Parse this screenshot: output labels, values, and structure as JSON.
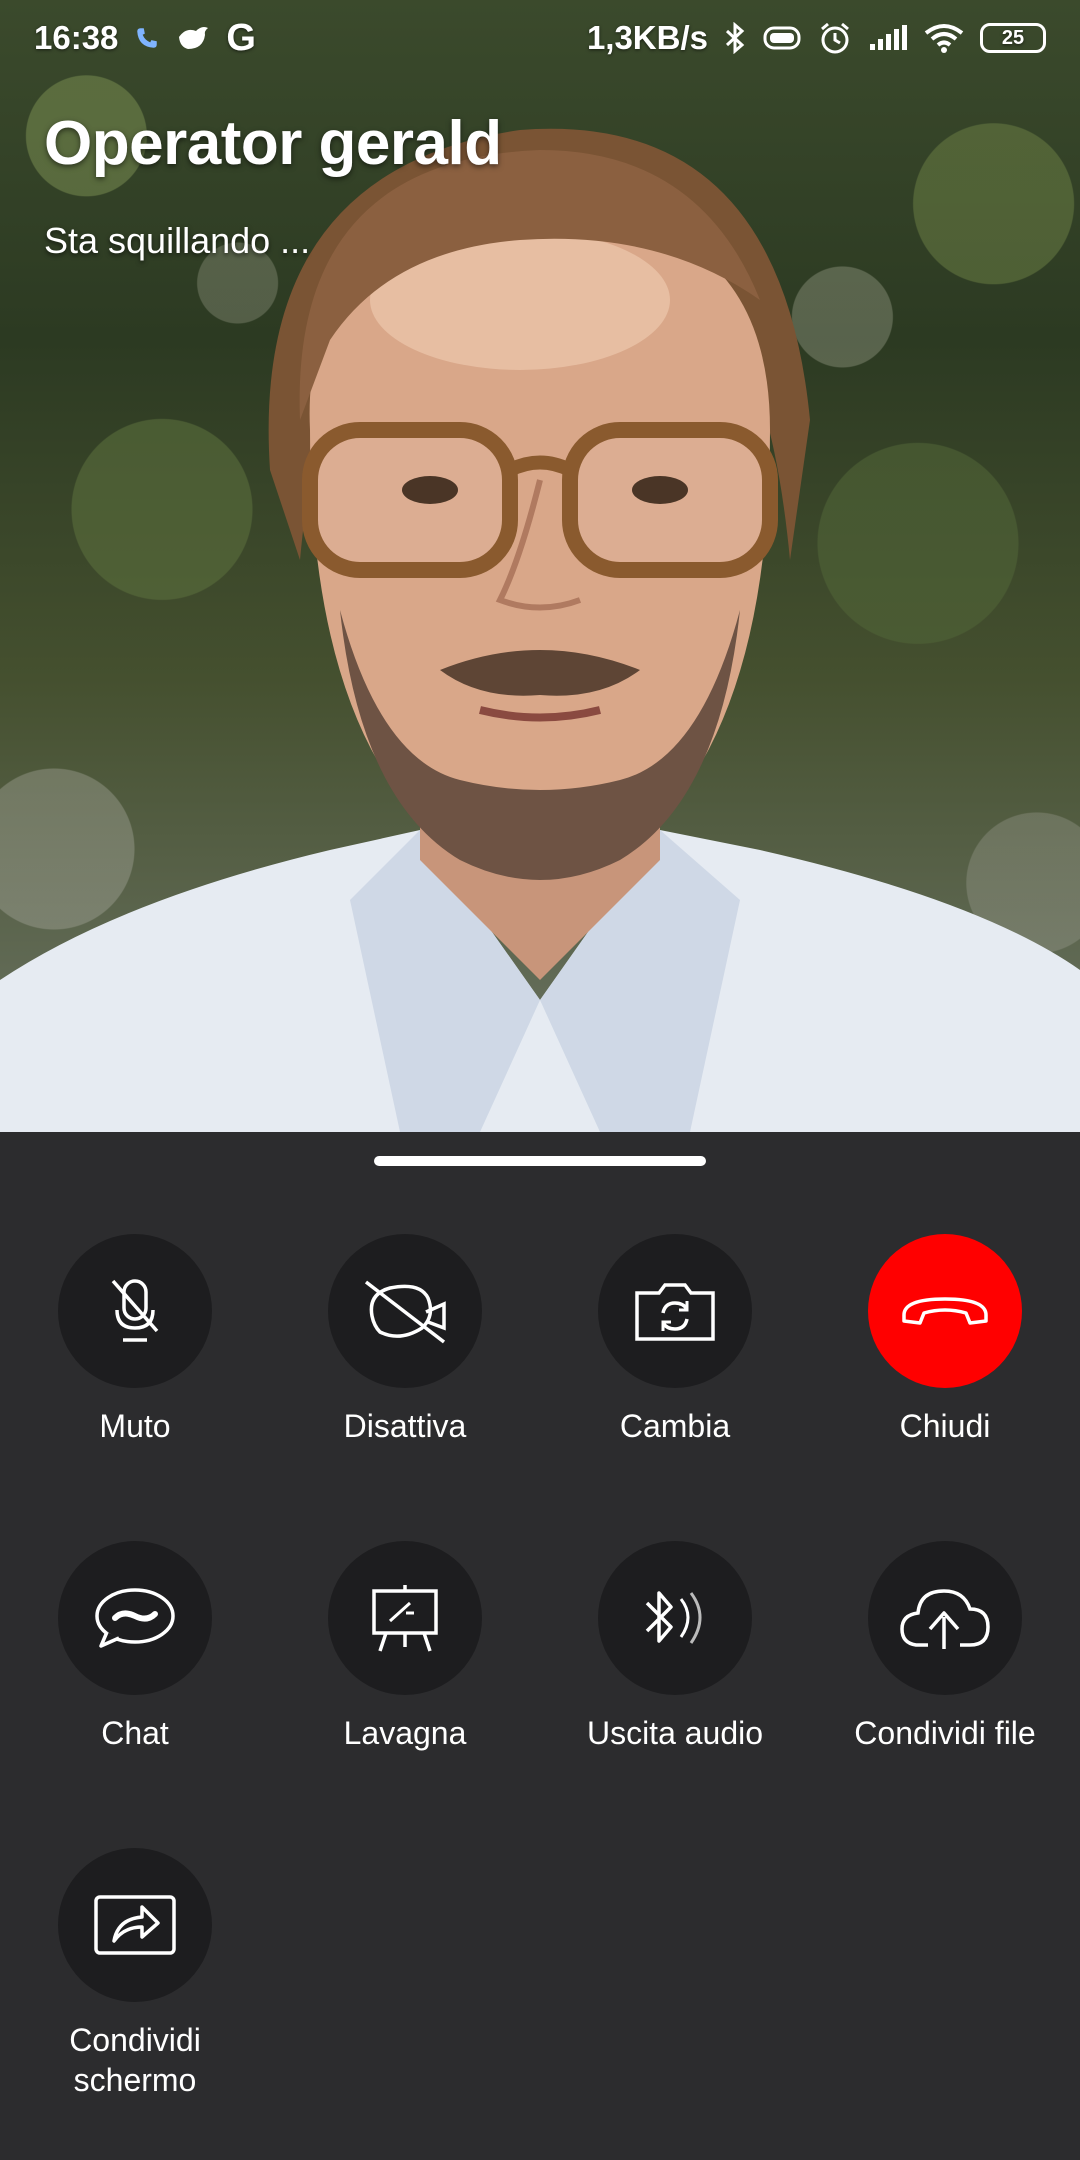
{
  "status_bar": {
    "time": "16:38",
    "net_speed": "1,3KB/s",
    "battery": "25",
    "icons": [
      "phone-icon",
      "bird-icon",
      "google-icon",
      "bluetooth-icon",
      "vibrate-icon",
      "alarm-icon",
      "signal-icon",
      "wifi-icon",
      "battery-icon"
    ]
  },
  "call": {
    "caller_name": "Operator gerald",
    "status": "Sta squillando ..."
  },
  "controls": {
    "mute": {
      "label": "Muto",
      "icon": "mic-off-icon"
    },
    "disable_video": {
      "label": "Disattiva",
      "icon": "video-off-icon"
    },
    "switch_camera": {
      "label": "Cambia",
      "icon": "camera-switch-icon"
    },
    "hang_up": {
      "label": "Chiudi",
      "icon": "hang-up-icon",
      "color": "#ff0000"
    },
    "chat": {
      "label": "Chat",
      "icon": "chat-icon"
    },
    "whiteboard": {
      "label": "Lavagna",
      "icon": "whiteboard-icon"
    },
    "audio_output": {
      "label": "Uscita audio",
      "icon": "bluetooth-audio-icon"
    },
    "share_file": {
      "label": "Condividi file",
      "icon": "cloud-upload-icon"
    },
    "share_screen": {
      "label": "Condividi\nschermo",
      "icon": "share-screen-icon"
    }
  },
  "colors": {
    "sheet_background": "#2c2c2e",
    "button_background": "#1d1d1f",
    "end_call": "#ff0000"
  }
}
